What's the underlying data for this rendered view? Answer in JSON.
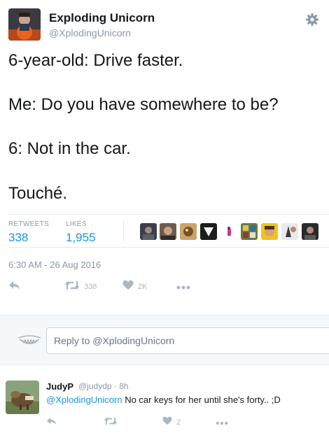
{
  "author": {
    "name": "Exploding Unicorn",
    "handle": "@XplodingUnicorn"
  },
  "tweet": {
    "lines": [
      "6-year-old: Drive faster.",
      "Me: Do you have somewhere to be?",
      "6: Not in the car.",
      "Touché."
    ],
    "retweets_label": "RETWEETS",
    "retweets_count": "338",
    "likes_label": "LIKES",
    "likes_count": "1,955",
    "timestamp": "6:30 AM - 26 Aug 2016"
  },
  "actions": {
    "retweet_count": "338",
    "like_count": "2K"
  },
  "reply_box": {
    "placeholder": "Reply to @XplodingUnicorn"
  },
  "reply": {
    "name": "JudyP",
    "handle_time": "@judydp · 8h",
    "mention": "@XplodingUnicorn",
    "text": " No car keys for her until she's forty.. ;D",
    "like_count": "2"
  },
  "colors": {
    "link": "#1b95e0",
    "muted": "#8899a6",
    "icon": "#aab8c2"
  },
  "icons": {
    "settings": "gear-icon",
    "reply": "reply-icon",
    "retweet": "retweet-icon",
    "like": "heart-icon",
    "more": "more-icon"
  }
}
